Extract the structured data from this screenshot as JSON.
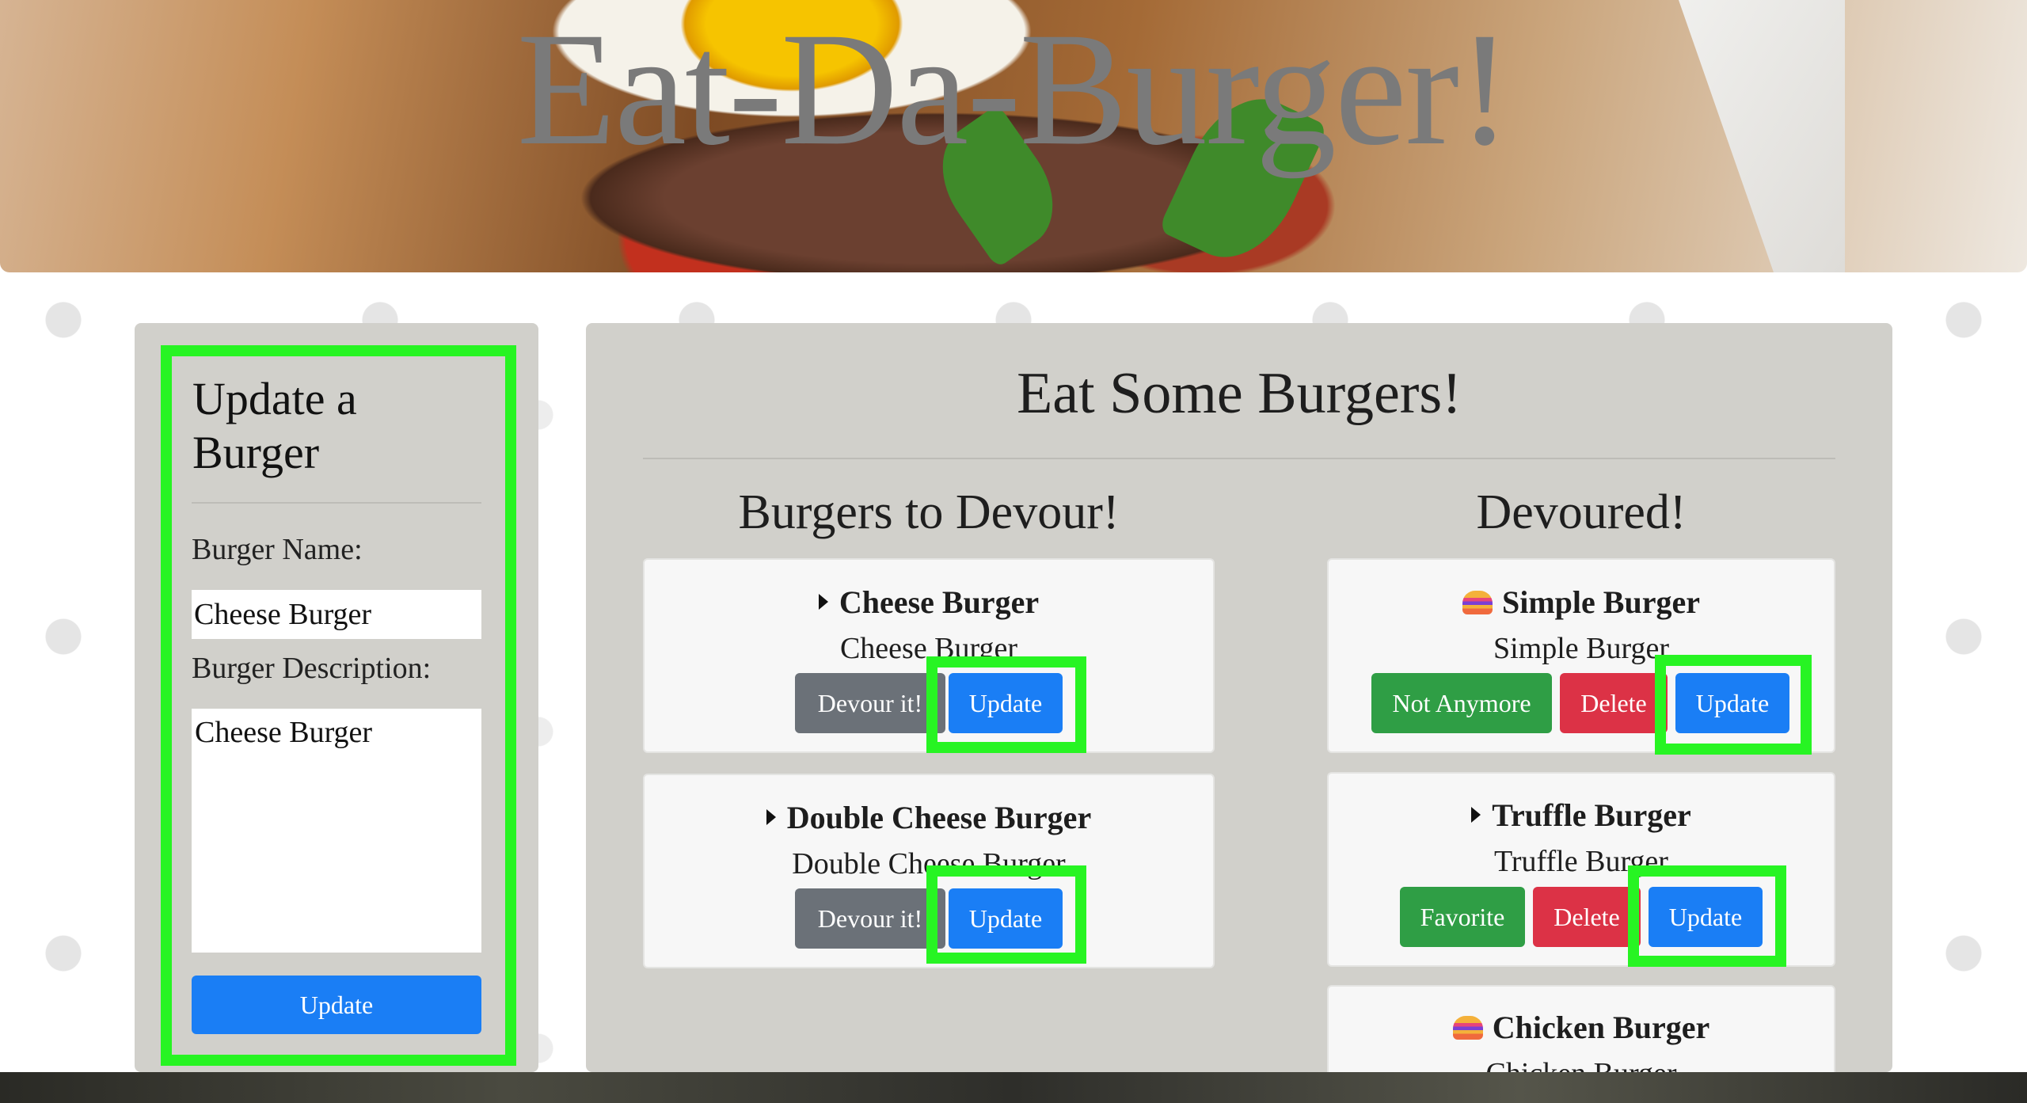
{
  "header": {
    "title": "Eat-Da-Burger!"
  },
  "update_form": {
    "heading": "Update a Burger",
    "name_label": "Burger Name:",
    "name_value": "Cheese Burger",
    "description_label": "Burger Description:",
    "description_value": "Cheese Burger",
    "submit_label": "Update"
  },
  "main": {
    "title": "Eat Some Burgers!",
    "to_devour": {
      "title": "Burgers to Devour!",
      "cards": [
        {
          "name": "Cheese Burger",
          "description": "Cheese Burger",
          "icon": "caret-right-icon",
          "buttons": [
            "Devour it!",
            "Update"
          ]
        },
        {
          "name": "Double Cheese Burger",
          "description": "Double Cheese Burger",
          "icon": "caret-right-icon",
          "buttons": [
            "Devour it!",
            "Update"
          ]
        }
      ]
    },
    "devoured": {
      "title": "Devoured!",
      "cards": [
        {
          "name": "Simple Burger",
          "description": "Simple Burger",
          "icon": "burger-icon",
          "buttons": [
            "Not Anymore",
            "Delete",
            "Update"
          ]
        },
        {
          "name": "Truffle Burger",
          "description": "Truffle Burger",
          "icon": "caret-right-icon",
          "buttons": [
            "Favorite",
            "Delete",
            "Update"
          ]
        },
        {
          "name": "Chicken Burger",
          "description": "Chicken Burger",
          "icon": "burger-icon",
          "buttons": []
        }
      ]
    }
  },
  "colors": {
    "highlight": "#27f423",
    "primary": "#1a7ef5",
    "secondary": "#6b7178",
    "success": "#2f9e45",
    "danger": "#dc3246",
    "panel": "#d1d0cb"
  }
}
